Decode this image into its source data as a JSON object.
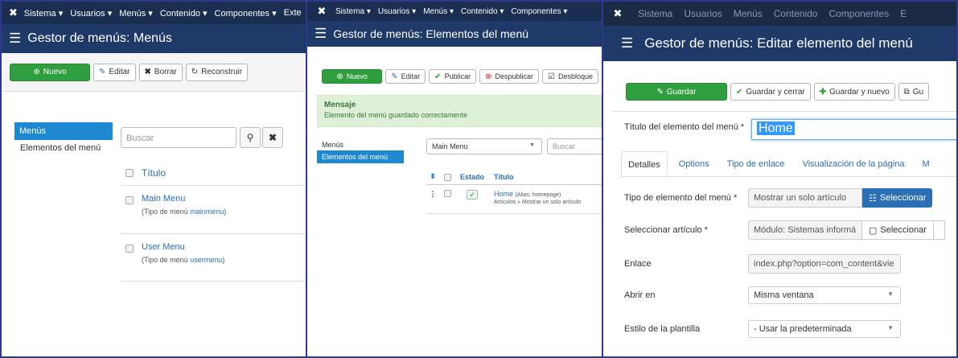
{
  "nav": {
    "items": [
      "Sistema ▾",
      "Usuarios ▾",
      "Menús ▾",
      "Contenido ▾",
      "Componentes ▾",
      "Exte"
    ],
    "items2": [
      "Sistema ▾",
      "Usuarios ▾",
      "Menús ▾",
      "Contenido ▾",
      "Componentes ▾"
    ],
    "items3": [
      "Sistema",
      "Usuarios",
      "Menús",
      "Contenido",
      "Componentes",
      "E"
    ]
  },
  "pane1": {
    "title": "Gestor de menús: Menús",
    "toolbar": {
      "new": "Nuevo",
      "edit": "Editar",
      "delete": "Borrar",
      "rebuild": "Reconstruir"
    },
    "sidebar": {
      "active": "Menús",
      "item": "Elementos del menú"
    },
    "search_placeholder": "Buscar",
    "table": {
      "header": "Título",
      "rows": [
        {
          "name": "Main Menu",
          "type_prefix": "(Tipo de menú",
          "type": "mainmenu",
          "type_suffix": ")"
        },
        {
          "name": "User Menu",
          "type_prefix": "(Tipo de menú",
          "type": "usermenu",
          "type_suffix": ")"
        }
      ]
    }
  },
  "pane2": {
    "title": "Gestor de menús: Elementos del menú",
    "toolbar": {
      "new": "Nuevo",
      "edit": "Editar",
      "publish": "Publicar",
      "unpublish": "Despublicar",
      "unblock": "Desbloque"
    },
    "message": {
      "title": "Mensaje",
      "text": "Elemento del menú guardado correctamente"
    },
    "sidebar": {
      "item": "Menús",
      "active": "Elementos del menú"
    },
    "menu_select": "Main Menu",
    "search_placeholder": "Buscar",
    "table": {
      "sort_icon": "⬍",
      "status_header": "Estado",
      "title_header": "Título",
      "row": {
        "title": "Home",
        "alias": "(Alias: homepage)",
        "type": "Artículos » Mostrar un solo artículo",
        "drag": "⋮",
        "status": "✓"
      }
    }
  },
  "pane3": {
    "title": "Gestor de menús: Editar elemento del menú",
    "toolbar": {
      "save": "Guardar",
      "save_close": "Guardar y cerrar",
      "save_new": "Guardar y nuevo",
      "copy": "Gu"
    },
    "title_label": "Título del elemento del menú *",
    "title_value": "Home",
    "tabs": [
      "Detalles",
      "Options",
      "Tipo de enlace",
      "Visualización de la página",
      "M"
    ],
    "fields": {
      "type_label": "Tipo de elemento del menú *",
      "type_value": "Mostrar un solo artículo",
      "type_button": "Seleccionar",
      "article_label": "Seleccionar artículo *",
      "article_value": "Módulo: Sistemas informá",
      "article_button": "Seleccionar",
      "link_label": "Enlace",
      "link_value": "index.php?option=com_content&vie",
      "open_label": "Abrir en",
      "open_value": "Misma ventana",
      "template_label": "Estilo de la plantilla",
      "template_value": "- Usar la predeterminada"
    }
  },
  "colors": {
    "nav": "#1a2e52",
    "title": "#1f3a68",
    "green": "#2f9e3f",
    "blue": "#1e88d0",
    "frame": "#2d3a8c"
  }
}
